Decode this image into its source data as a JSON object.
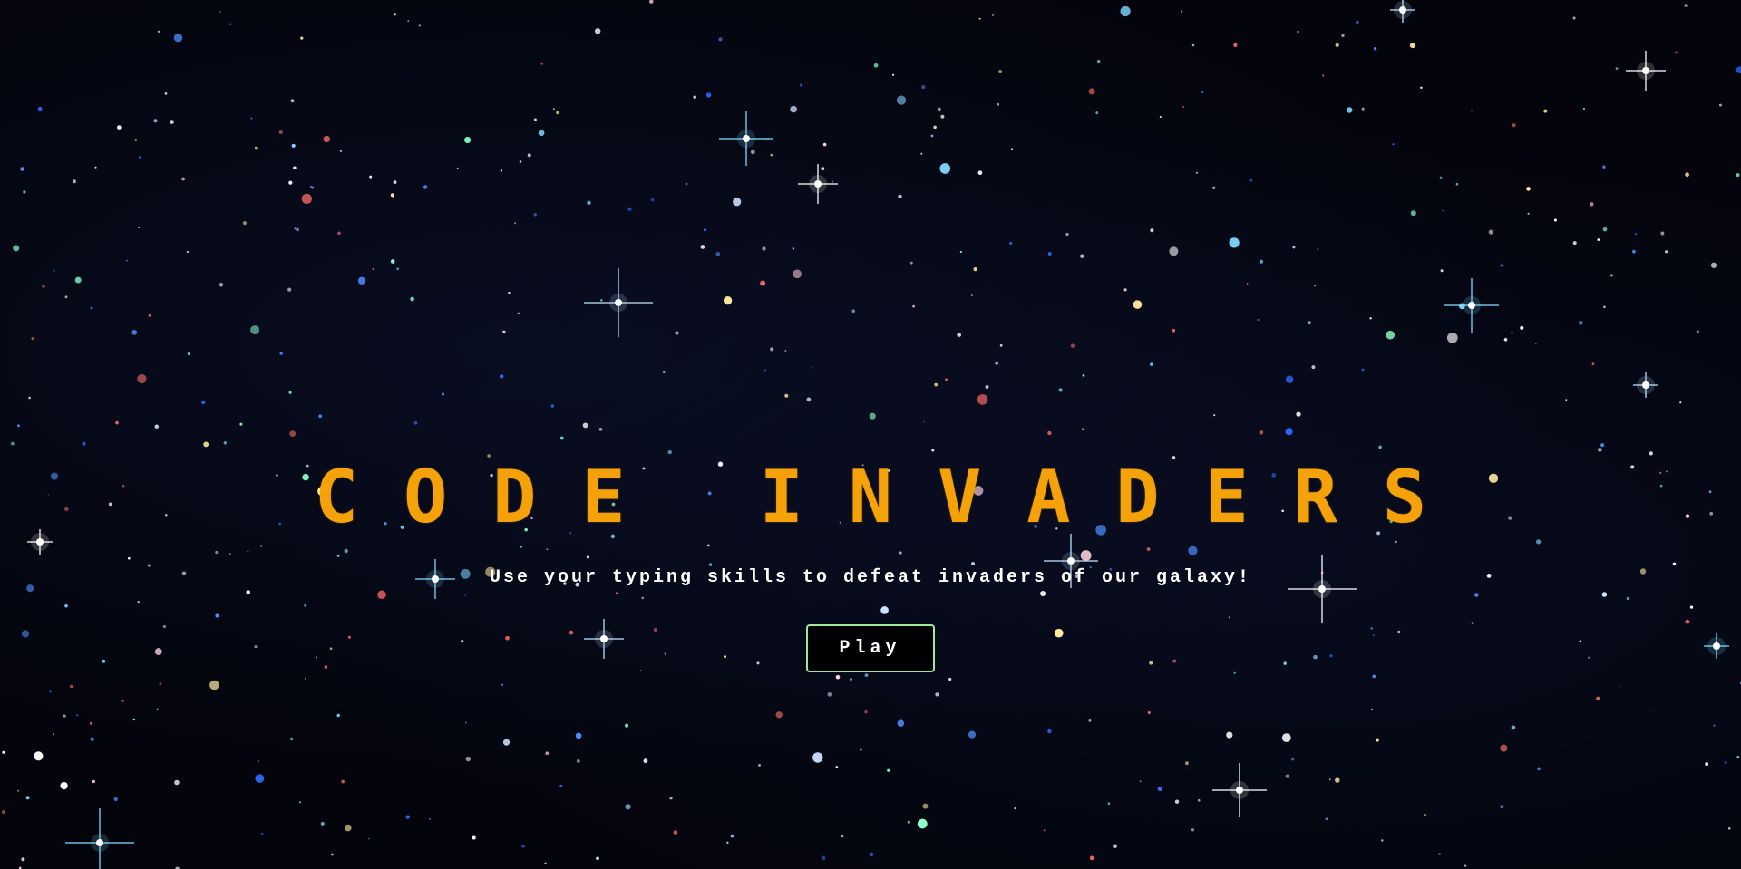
{
  "game": {
    "title": "CODE INVADERS",
    "tagline": "Use your typing skills to defeat invaders of our galaxy!",
    "play_label": "Play"
  },
  "background": {
    "image": "starfield",
    "color": "#03040c"
  },
  "colors": {
    "title": "#f5a20a",
    "text": "#ffffff",
    "button_border": "#9ee89a"
  }
}
